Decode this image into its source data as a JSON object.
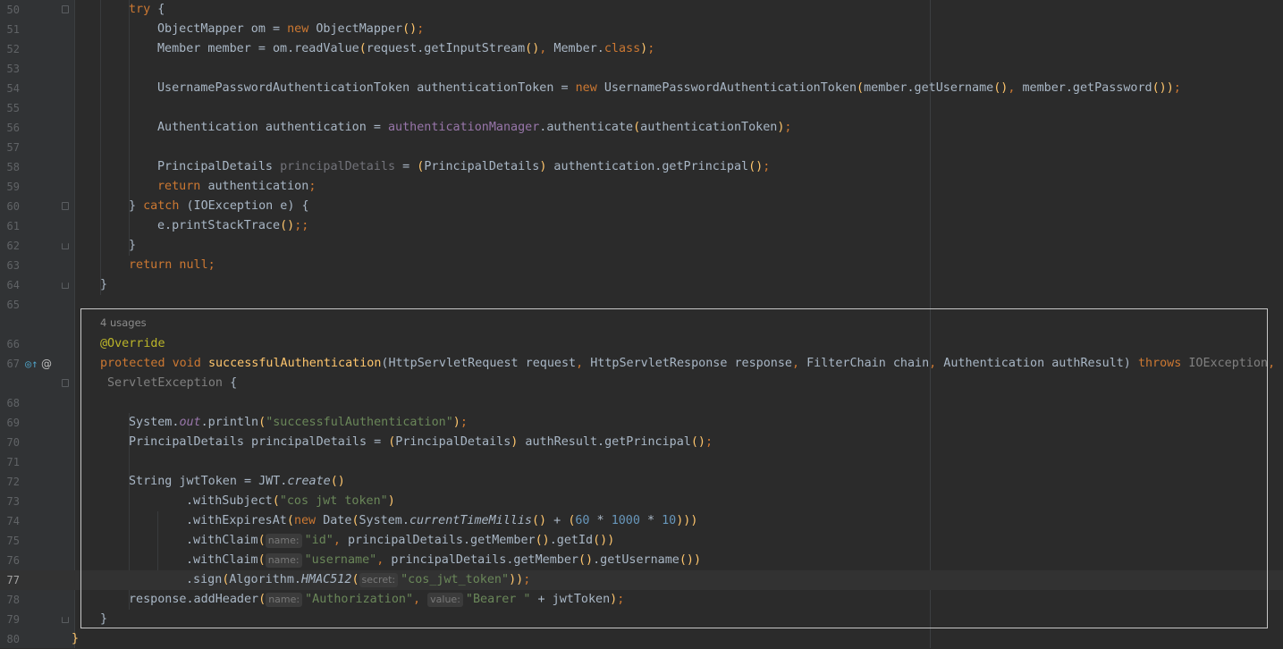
{
  "editor": {
    "usages_hint": "4 usages",
    "gutter_icons": {
      "override_icon": "override-method-icon",
      "annotation_icon": "@"
    },
    "lines": [
      {
        "num": "50",
        "tokens": [
          [
            "kw",
            "try "
          ],
          [
            "",
            "{"
          ]
        ]
      },
      {
        "num": "51",
        "tokens": [
          [
            "",
            "ObjectMapper om = "
          ],
          [
            "kw",
            "new "
          ],
          [
            "",
            "ObjectMapper"
          ],
          [
            "fn",
            "()"
          ],
          [
            "kw",
            ";"
          ]
        ]
      },
      {
        "num": "52",
        "tokens": [
          [
            "",
            "Member member = om.readValue"
          ],
          [
            "fn",
            "("
          ],
          [
            "",
            "request.getInputStream"
          ],
          [
            "fn",
            "()"
          ],
          [
            "kw",
            ", "
          ],
          [
            "",
            "Member."
          ],
          [
            "kw",
            "class"
          ],
          [
            "fn",
            ")"
          ],
          [
            "kw",
            ";"
          ]
        ]
      },
      {
        "num": "53",
        "tokens": []
      },
      {
        "num": "54",
        "tokens": [
          [
            "",
            "UsernamePasswordAuthenticationToken authenticationToken = "
          ],
          [
            "kw",
            "new "
          ],
          [
            "",
            "UsernamePasswordAuthenticationToken"
          ],
          [
            "fn",
            "("
          ],
          [
            "",
            "member.getUsername"
          ],
          [
            "fn",
            "()"
          ],
          [
            "kw",
            ", "
          ],
          [
            "",
            "member.getPassword"
          ],
          [
            "fn",
            "())"
          ],
          [
            "kw",
            ";"
          ]
        ]
      },
      {
        "num": "55",
        "tokens": []
      },
      {
        "num": "56",
        "tokens": [
          [
            "",
            "Authentication authentication = "
          ],
          [
            "fld",
            "authenticationManager"
          ],
          [
            "",
            ".authenticate"
          ],
          [
            "fn",
            "("
          ],
          [
            "",
            "authenticationToken"
          ],
          [
            "fn",
            ")"
          ],
          [
            "kw",
            ";"
          ]
        ]
      },
      {
        "num": "57",
        "tokens": []
      },
      {
        "num": "58",
        "tokens": [
          [
            "",
            "PrincipalDetails "
          ],
          [
            "unused",
            "principalDetails"
          ],
          [
            "",
            " = "
          ],
          [
            "fn",
            "("
          ],
          [
            "",
            "PrincipalDetails"
          ],
          [
            "fn",
            ")"
          ],
          [
            "",
            " authentication.getPrincipal"
          ],
          [
            "fn",
            "()"
          ],
          [
            "kw",
            ";"
          ]
        ]
      },
      {
        "num": "59",
        "tokens": [
          [
            "kw",
            "return "
          ],
          [
            "",
            "authentication"
          ],
          [
            "kw",
            ";"
          ]
        ]
      },
      {
        "num": "60",
        "tokens": [
          [
            "",
            "} "
          ],
          [
            "kw",
            "catch "
          ],
          [
            "",
            "(IOException e) {"
          ]
        ]
      },
      {
        "num": "61",
        "tokens": [
          [
            "",
            "e.printStackTrace"
          ],
          [
            "fn",
            "()"
          ],
          [
            "kw",
            ";;"
          ]
        ]
      },
      {
        "num": "62",
        "tokens": [
          [
            "",
            "}"
          ]
        ]
      },
      {
        "num": "63",
        "tokens": [
          [
            "kw",
            "return null;"
          ]
        ]
      },
      {
        "num": "64",
        "tokens": [
          [
            "",
            "}"
          ]
        ]
      },
      {
        "num": "65",
        "tokens": []
      },
      {
        "num": "66",
        "tokens": [
          [
            "ann",
            "@Override"
          ]
        ]
      },
      {
        "num": "67",
        "tokens": [
          [
            "kw",
            "protected void "
          ],
          [
            "fn",
            "successfulAuthentication"
          ],
          [
            "",
            "(HttpServletRequest request"
          ],
          [
            "kw",
            ", "
          ],
          [
            "",
            "HttpServletResponse response"
          ],
          [
            "kw",
            ", "
          ],
          [
            "",
            "FilterChain chain"
          ],
          [
            "kw",
            ", "
          ],
          [
            "",
            "Authentication authResult) "
          ],
          [
            "kw",
            "throws "
          ],
          [
            "gray",
            "IOException"
          ],
          [
            "kw",
            ","
          ]
        ]
      },
      {
        "num": "",
        "tokens": [
          [
            "gray",
            "ServletException "
          ],
          [
            "",
            "{"
          ]
        ]
      },
      {
        "num": "68",
        "tokens": []
      },
      {
        "num": "69",
        "tokens": [
          [
            "",
            "System."
          ],
          [
            "ifld",
            "out"
          ],
          [
            "",
            ".println"
          ],
          [
            "fn",
            "("
          ],
          [
            "str",
            "\"successfulAuthentication\""
          ],
          [
            "fn",
            ")"
          ],
          [
            "kw",
            ";"
          ]
        ]
      },
      {
        "num": "70",
        "tokens": [
          [
            "",
            "PrincipalDetails principalDetails = "
          ],
          [
            "fn",
            "("
          ],
          [
            "",
            "PrincipalDetails"
          ],
          [
            "fn",
            ")"
          ],
          [
            "",
            " authResult.getPrincipal"
          ],
          [
            "fn",
            "()"
          ],
          [
            "kw",
            ";"
          ]
        ]
      },
      {
        "num": "71",
        "tokens": []
      },
      {
        "num": "72",
        "tokens": [
          [
            "",
            "String jwtToken = JWT."
          ],
          [
            "stc",
            "create"
          ],
          [
            "fn",
            "()"
          ]
        ]
      },
      {
        "num": "73",
        "tokens": [
          [
            "",
            ".withSubject"
          ],
          [
            "fn",
            "("
          ],
          [
            "str",
            "\"cos jwt token\""
          ],
          [
            "fn",
            ")"
          ]
        ]
      },
      {
        "num": "74",
        "tokens": [
          [
            "",
            ".withExpiresAt"
          ],
          [
            "fn",
            "("
          ],
          [
            "kw",
            "new "
          ],
          [
            "",
            "Date"
          ],
          [
            "fn",
            "("
          ],
          [
            "",
            "System."
          ],
          [
            "stc",
            "currentTimeMillis"
          ],
          [
            "fn",
            "()"
          ],
          [
            "",
            " + "
          ],
          [
            "fn",
            "("
          ],
          [
            "num",
            "60"
          ],
          [
            "",
            " * "
          ],
          [
            "num",
            "1000"
          ],
          [
            "",
            " * "
          ],
          [
            "num",
            "10"
          ],
          [
            "fn",
            ")))"
          ]
        ]
      },
      {
        "num": "75",
        "tokens": [
          [
            "",
            ".withClaim"
          ],
          [
            "fn",
            "("
          ],
          [
            "hint",
            "name:"
          ],
          [
            "str",
            "\"id\""
          ],
          [
            "kw",
            ", "
          ],
          [
            "",
            "principalDetails.getMember"
          ],
          [
            "fn",
            "()"
          ],
          [
            "",
            ".getId"
          ],
          [
            "fn",
            "())"
          ]
        ]
      },
      {
        "num": "76",
        "tokens": [
          [
            "",
            ".withClaim"
          ],
          [
            "fn",
            "("
          ],
          [
            "hint",
            "name:"
          ],
          [
            "str",
            "\"username\""
          ],
          [
            "kw",
            ", "
          ],
          [
            "",
            "principalDetails.getMember"
          ],
          [
            "fn",
            "()"
          ],
          [
            "",
            ".getUsername"
          ],
          [
            "fn",
            "())"
          ]
        ]
      },
      {
        "num": "77",
        "tokens": [
          [
            "",
            ".sign"
          ],
          [
            "fn",
            "("
          ],
          [
            "",
            "Algorithm."
          ],
          [
            "stc",
            "HMAC512"
          ],
          [
            "fn",
            "("
          ],
          [
            "hint",
            "secret:"
          ],
          [
            "str",
            "\"cos_jwt_token\""
          ],
          [
            "fn",
            "))"
          ],
          [
            "kw",
            ";"
          ]
        ]
      },
      {
        "num": "78",
        "tokens": [
          [
            "",
            "response.addHeader"
          ],
          [
            "fn",
            "("
          ],
          [
            "hint",
            "name:"
          ],
          [
            "str",
            "\"Authorization\""
          ],
          [
            "kw",
            ", "
          ],
          [
            "hint",
            "value:"
          ],
          [
            "str",
            "\"Bearer \""
          ],
          [
            "",
            " + jwtToken"
          ],
          [
            "fn",
            ")"
          ],
          [
            "kw",
            ";"
          ]
        ]
      },
      {
        "num": "79",
        "tokens": [
          [
            "",
            "}"
          ]
        ]
      },
      {
        "num": "80",
        "tokens": [
          [
            "fn",
            "}"
          ]
        ]
      }
    ]
  }
}
